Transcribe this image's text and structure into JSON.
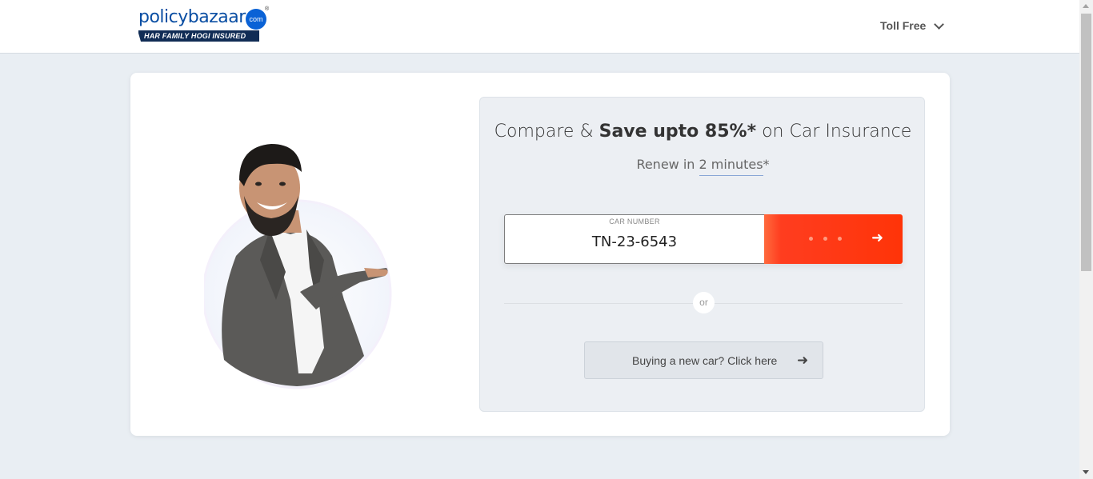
{
  "header": {
    "logo": {
      "policy": "policy",
      "bazaar": "bazaar",
      "com": "com",
      "registered": "®",
      "tagline": "HAR FAMILY HOGI INSURED"
    },
    "toll_free_label": "Toll Free",
    "toll_free_icon": "chevron-down-icon"
  },
  "hero": {
    "image_alt": "spokesperson-pointing"
  },
  "main": {
    "headline_prefix": "Compare & ",
    "headline_bold": "Save upto 85%*",
    "headline_suffix": " on Car Insurance",
    "sub_prefix": "Renew in ",
    "sub_highlight": "2 minutes",
    "sub_suffix": "*",
    "car_number_label": "CAR NUMBER",
    "car_number_value": "TN-23-6543",
    "submit_icon": "arrow-right-icon",
    "divider_text": "or",
    "new_car_label": "Buying a new car? Click here",
    "new_car_icon": "arrow-right-icon"
  },
  "colors": {
    "brand_blue": "#0a4ea3",
    "cta_orange": "#ff3408",
    "page_bg": "#e9eef3"
  }
}
